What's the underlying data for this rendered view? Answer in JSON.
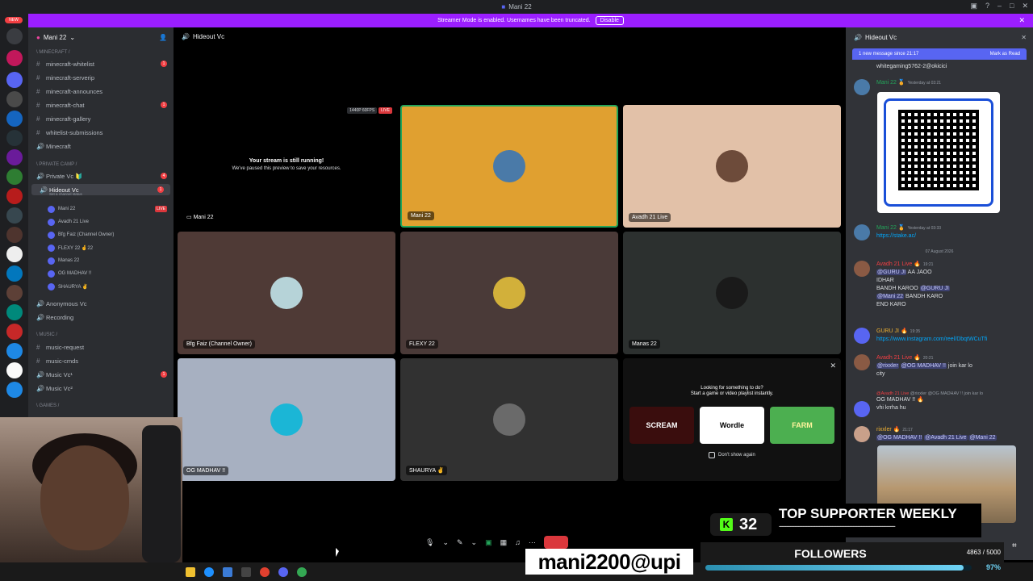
{
  "window": {
    "title": "Mani 22"
  },
  "streamer_mode": {
    "text": "Streamer Mode is enabled. Usernames have been truncated.",
    "disable_label": "Disable"
  },
  "rail": {
    "new_label": "NEW"
  },
  "guild": {
    "name": "Mani 22"
  },
  "channels": [
    {
      "type": "category",
      "label": "\\ MINECRAFT /"
    },
    {
      "type": "text",
      "label": "minecraft-whitelist",
      "badge": "1"
    },
    {
      "type": "text",
      "label": "minecraft-serverip"
    },
    {
      "type": "text",
      "label": "minecraft-announces"
    },
    {
      "type": "text",
      "label": "minecraft-chat",
      "badge": "1"
    },
    {
      "type": "text",
      "label": "minecraft-gallery"
    },
    {
      "type": "text",
      "label": "whitelist-submissions"
    },
    {
      "type": "voice",
      "label": "Minecraft"
    },
    {
      "type": "category",
      "label": "\\ PRIVATE CAMP /"
    },
    {
      "type": "voice",
      "label": "Private Vc 🔰",
      "badge": "4"
    },
    {
      "type": "voice-active",
      "label": "Hideout Vc",
      "sub": "Set a channel status",
      "badge": "1"
    },
    {
      "type": "member",
      "label": "Mani 22",
      "live": "LIVE"
    },
    {
      "type": "member",
      "label": "Avadh 21 Live"
    },
    {
      "type": "member",
      "label": "Bfg Faiz (Channel Owner)"
    },
    {
      "type": "member",
      "label": "FLEXY 22 🤞22"
    },
    {
      "type": "member",
      "label": "Manas 22"
    },
    {
      "type": "member",
      "label": "OG MADHAV !!"
    },
    {
      "type": "member",
      "label": "SHAURYA ✌"
    },
    {
      "type": "voice",
      "label": "Anonymous Vc"
    },
    {
      "type": "voice",
      "label": "Recording"
    },
    {
      "type": "category",
      "label": "\\ MUSIC /"
    },
    {
      "type": "text",
      "label": "music-request"
    },
    {
      "type": "text",
      "label": "music-cmds"
    },
    {
      "type": "voice",
      "label": "Music Vc¹",
      "badge": "1"
    },
    {
      "type": "voice",
      "label": "Music Vc²"
    },
    {
      "type": "category",
      "label": "\\ GAMES /"
    }
  ],
  "call": {
    "header": "Hideout Vc",
    "stream_tile": {
      "quality": "1440P 60FPS",
      "live": "LIVE",
      "heading": "Your stream is still running!",
      "sub": "We've paused this preview to save your resources.",
      "name": "Mani 22"
    },
    "tiles": [
      {
        "name": "Mani 22",
        "bg": "#e0a030",
        "avatar": "#4a7aa8"
      },
      {
        "name": "Avadh 21 Live",
        "bg": "#e2c1a8",
        "avatar": "#6d4b3a"
      },
      {
        "name": "Bfg Faiz (Channel Owner)",
        "bg": "#4f3a36",
        "avatar": "#b6d3d8"
      },
      {
        "name": "FLEXY 22",
        "bg": "#4a3a38",
        "avatar": "#d2b03a"
      },
      {
        "name": "Manas 22",
        "bg": "#2c302f",
        "avatar": "#1a1a1a"
      },
      {
        "name": "OG MADHAV !!",
        "bg": "#a7b0c1",
        "avatar": "#1bb6d6"
      },
      {
        "name": "SHAURYA ✌",
        "bg": "#313131",
        "avatar": "#6a6a6a"
      }
    ],
    "activity": {
      "line1": "Looking for something to do?",
      "line2": "Start a game or video playlist instantly.",
      "games": [
        "SCREAM",
        "Wordle",
        "FARM"
      ],
      "dont_show": "Don't show again"
    }
  },
  "chat": {
    "header": "Hideout Vc",
    "new_messages": "1 new message since 21:17",
    "mark_read": "Mark as Read",
    "top_line": "whitegaming5762-2@okicici",
    "messages": [
      {
        "who": "Mani 22 🏅",
        "time": "Yesterday at 03:21"
      },
      {
        "who": "Mani 22 🏅",
        "time": "Yesterday at 03:33",
        "link": "https://stake.ac/"
      }
    ],
    "date_divider": "07 August 2026",
    "messages2": [
      {
        "who": "Avadh 21 Live 🔥",
        "time": "19:21",
        "l1a": "@GURU JI",
        "l1b": " AA JAOO",
        "l2": "IDHAR",
        "l3a": "BANDH KAROO ",
        "l3b": "@GURU JI",
        "l4a": "@Mani 22",
        "l4b": " BANDH KARO",
        "l5": "END KARO"
      },
      {
        "who": "GURU JI 🔥",
        "time": "19:35",
        "link": "https://www.instagram.com/reel/DbqtWCuTfi"
      },
      {
        "who": "Avadh 21 Live 🔥",
        "time": "20:21",
        "l1a": "@rixxler",
        "l1b": "@OG MADHAV !!",
        "l1c": " join kar lo",
        "l2": "city"
      },
      {
        "who": "@Avadh 21 Live",
        "reply": "@rixxler @OG MADHAV !! join kar lo",
        "l1": "OG MADHAV !! 🔥",
        "l2": "vhi krrha hu"
      },
      {
        "who": "rixxler 🔥",
        "time": "21:17",
        "l1a": "@OG MADHAV !!",
        "l1b": "@Avadh 21 Live",
        "l1c": "@Mani 22"
      }
    ]
  },
  "overlay": {
    "upi": "mani2200@upi",
    "kick_count": "32",
    "top_supporter": "TOP SUPPORTER WEEKLY",
    "dashes": "------------------------------------------------------------------------",
    "followers_label": "FOLLOWERS",
    "followers_count": "4863 / 5000",
    "followers_pct": "97%",
    "followers_fraction": 0.97
  },
  "colors": {
    "accent": "#5865f2",
    "streamer": "#9b1eff",
    "danger": "#da373c",
    "kick": "#53fc18"
  }
}
